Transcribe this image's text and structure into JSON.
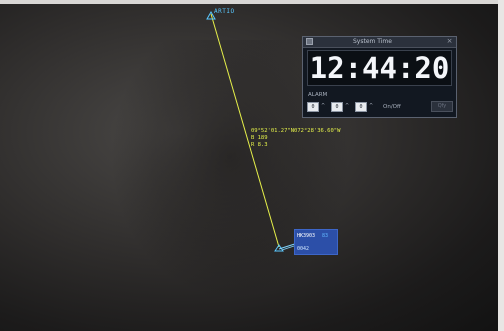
{
  "colors": {
    "route_line": "#e6f04a",
    "waypoint": "#5ac8ff",
    "readout_text": "#e4f04a",
    "track_block": "#2c4fa8",
    "clock_text": "#f4f6fa"
  },
  "radar": {
    "waypoint": {
      "name": "ARTIO",
      "icon": "waypoint-triangle-icon"
    },
    "readout": {
      "coords": "09°52'01.27\"N072°28'36.60\"W",
      "line2": "B 189",
      "line3": "R 8.3"
    },
    "aircraft": {
      "callsign": "HK3903",
      "altitude": "83",
      "squawk": "0042",
      "icon": "aircraft-target-icon"
    }
  },
  "system_time": {
    "title": "System Time",
    "clock": "12:44:20",
    "alarm": {
      "label": "ALARM",
      "fields": [
        "0",
        "0",
        "0"
      ],
      "separators": [
        "^",
        "^",
        "^"
      ],
      "toggle_label": "On/Off",
      "apply_label": "Qfy"
    }
  }
}
